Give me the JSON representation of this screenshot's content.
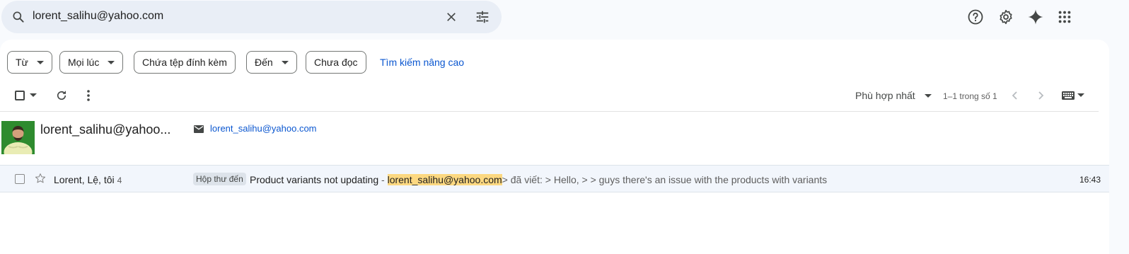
{
  "search": {
    "query": "lorent_salihu@yahoo.com"
  },
  "header_icons": [
    "help-icon",
    "settings-icon",
    "gemini-sparkle-icon",
    "apps-grid-icon"
  ],
  "filters": {
    "chips": [
      {
        "label": "Từ",
        "has_dropdown": true
      },
      {
        "label": "Mọi lúc",
        "has_dropdown": true
      },
      {
        "label": "Chứa tệp đính kèm",
        "has_dropdown": false
      },
      {
        "label": "Đến",
        "has_dropdown": true
      },
      {
        "label": "Chưa đọc",
        "has_dropdown": false
      }
    ],
    "advanced_link": "Tìm kiếm nâng cao"
  },
  "toolbar": {
    "sort_label": "Phù hợp nhất",
    "page_count": "1–1 trong số 1"
  },
  "contact": {
    "name": "lorent_salihu@yahoo...",
    "email": "lorent_salihu@yahoo.com"
  },
  "emails": [
    {
      "senders": "Lorent, Lệ, tôi",
      "count": "4",
      "label": "Hộp thư đến",
      "subject": "Product variants not updating",
      "separator": " - ",
      "highlight": "lorent_salihu@yahoo.com",
      "snippet": "> đã viết: > Hello, > > guys there's an issue with the products with variants",
      "time": "16:43"
    }
  ],
  "colors": {
    "accent": "#0b57d0",
    "highlight": "#fcd881",
    "background": "#f8fafd",
    "searchbar": "#e9eef6",
    "row_background": "#f2f6fc"
  }
}
